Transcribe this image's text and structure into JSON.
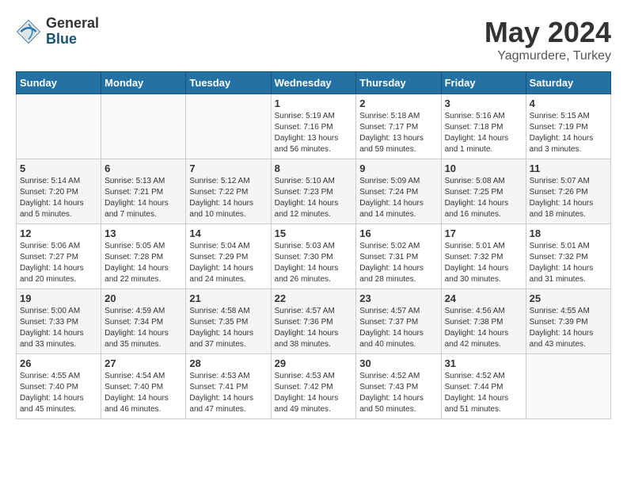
{
  "header": {
    "logo_general": "General",
    "logo_blue": "Blue",
    "title": "May 2024",
    "location": "Yagmurdere, Turkey"
  },
  "weekdays": [
    "Sunday",
    "Monday",
    "Tuesday",
    "Wednesday",
    "Thursday",
    "Friday",
    "Saturday"
  ],
  "weeks": [
    [
      {
        "day": "",
        "info": ""
      },
      {
        "day": "",
        "info": ""
      },
      {
        "day": "",
        "info": ""
      },
      {
        "day": "1",
        "info": "Sunrise: 5:19 AM\nSunset: 7:16 PM\nDaylight: 13 hours\nand 56 minutes."
      },
      {
        "day": "2",
        "info": "Sunrise: 5:18 AM\nSunset: 7:17 PM\nDaylight: 13 hours\nand 59 minutes."
      },
      {
        "day": "3",
        "info": "Sunrise: 5:16 AM\nSunset: 7:18 PM\nDaylight: 14 hours\nand 1 minute."
      },
      {
        "day": "4",
        "info": "Sunrise: 5:15 AM\nSunset: 7:19 PM\nDaylight: 14 hours\nand 3 minutes."
      }
    ],
    [
      {
        "day": "5",
        "info": "Sunrise: 5:14 AM\nSunset: 7:20 PM\nDaylight: 14 hours\nand 5 minutes."
      },
      {
        "day": "6",
        "info": "Sunrise: 5:13 AM\nSunset: 7:21 PM\nDaylight: 14 hours\nand 7 minutes."
      },
      {
        "day": "7",
        "info": "Sunrise: 5:12 AM\nSunset: 7:22 PM\nDaylight: 14 hours\nand 10 minutes."
      },
      {
        "day": "8",
        "info": "Sunrise: 5:10 AM\nSunset: 7:23 PM\nDaylight: 14 hours\nand 12 minutes."
      },
      {
        "day": "9",
        "info": "Sunrise: 5:09 AM\nSunset: 7:24 PM\nDaylight: 14 hours\nand 14 minutes."
      },
      {
        "day": "10",
        "info": "Sunrise: 5:08 AM\nSunset: 7:25 PM\nDaylight: 14 hours\nand 16 minutes."
      },
      {
        "day": "11",
        "info": "Sunrise: 5:07 AM\nSunset: 7:26 PM\nDaylight: 14 hours\nand 18 minutes."
      }
    ],
    [
      {
        "day": "12",
        "info": "Sunrise: 5:06 AM\nSunset: 7:27 PM\nDaylight: 14 hours\nand 20 minutes."
      },
      {
        "day": "13",
        "info": "Sunrise: 5:05 AM\nSunset: 7:28 PM\nDaylight: 14 hours\nand 22 minutes."
      },
      {
        "day": "14",
        "info": "Sunrise: 5:04 AM\nSunset: 7:29 PM\nDaylight: 14 hours\nand 24 minutes."
      },
      {
        "day": "15",
        "info": "Sunrise: 5:03 AM\nSunset: 7:30 PM\nDaylight: 14 hours\nand 26 minutes."
      },
      {
        "day": "16",
        "info": "Sunrise: 5:02 AM\nSunset: 7:31 PM\nDaylight: 14 hours\nand 28 minutes."
      },
      {
        "day": "17",
        "info": "Sunrise: 5:01 AM\nSunset: 7:32 PM\nDaylight: 14 hours\nand 30 minutes."
      },
      {
        "day": "18",
        "info": "Sunrise: 5:01 AM\nSunset: 7:32 PM\nDaylight: 14 hours\nand 31 minutes."
      }
    ],
    [
      {
        "day": "19",
        "info": "Sunrise: 5:00 AM\nSunset: 7:33 PM\nDaylight: 14 hours\nand 33 minutes."
      },
      {
        "day": "20",
        "info": "Sunrise: 4:59 AM\nSunset: 7:34 PM\nDaylight: 14 hours\nand 35 minutes."
      },
      {
        "day": "21",
        "info": "Sunrise: 4:58 AM\nSunset: 7:35 PM\nDaylight: 14 hours\nand 37 minutes."
      },
      {
        "day": "22",
        "info": "Sunrise: 4:57 AM\nSunset: 7:36 PM\nDaylight: 14 hours\nand 38 minutes."
      },
      {
        "day": "23",
        "info": "Sunrise: 4:57 AM\nSunset: 7:37 PM\nDaylight: 14 hours\nand 40 minutes."
      },
      {
        "day": "24",
        "info": "Sunrise: 4:56 AM\nSunset: 7:38 PM\nDaylight: 14 hours\nand 42 minutes."
      },
      {
        "day": "25",
        "info": "Sunrise: 4:55 AM\nSunset: 7:39 PM\nDaylight: 14 hours\nand 43 minutes."
      }
    ],
    [
      {
        "day": "26",
        "info": "Sunrise: 4:55 AM\nSunset: 7:40 PM\nDaylight: 14 hours\nand 45 minutes."
      },
      {
        "day": "27",
        "info": "Sunrise: 4:54 AM\nSunset: 7:40 PM\nDaylight: 14 hours\nand 46 minutes."
      },
      {
        "day": "28",
        "info": "Sunrise: 4:53 AM\nSunset: 7:41 PM\nDaylight: 14 hours\nand 47 minutes."
      },
      {
        "day": "29",
        "info": "Sunrise: 4:53 AM\nSunset: 7:42 PM\nDaylight: 14 hours\nand 49 minutes."
      },
      {
        "day": "30",
        "info": "Sunrise: 4:52 AM\nSunset: 7:43 PM\nDaylight: 14 hours\nand 50 minutes."
      },
      {
        "day": "31",
        "info": "Sunrise: 4:52 AM\nSunset: 7:44 PM\nDaylight: 14 hours\nand 51 minutes."
      },
      {
        "day": "",
        "info": ""
      }
    ]
  ]
}
